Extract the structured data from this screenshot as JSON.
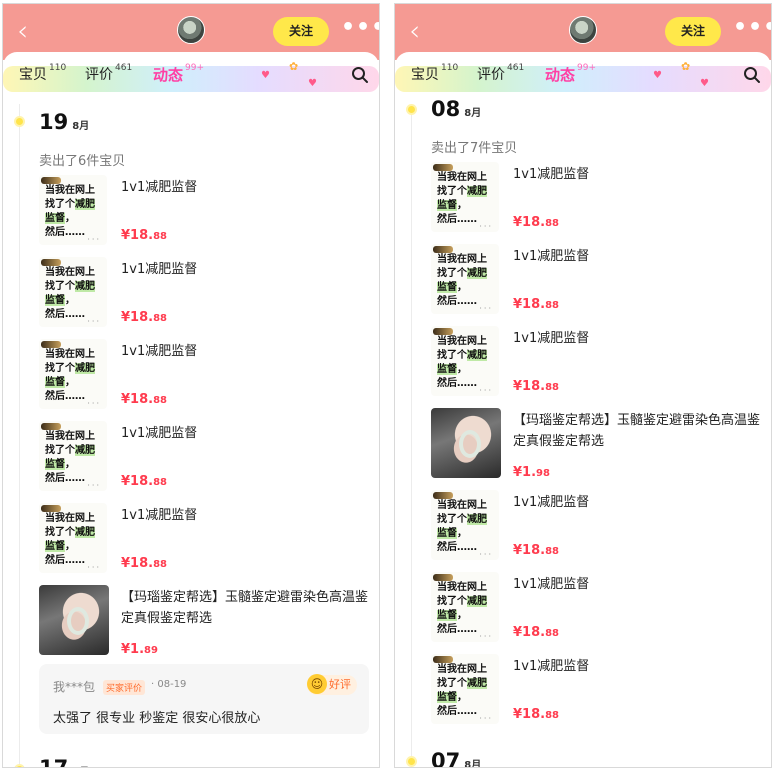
{
  "header": {
    "follow_label": "关注",
    "more_glyph": "•••",
    "back_glyph": "‹"
  },
  "tabs": [
    {
      "label": "宝贝",
      "count": "110"
    },
    {
      "label": "评价",
      "count": "461"
    },
    {
      "label": "动态",
      "count": "99+"
    }
  ],
  "thumb_text": {
    "line1": "当我在网上",
    "line2a": "找了个",
    "line2b": "减肥",
    "line3": "监督",
    "line3b": "，",
    "line4": "然后……",
    "dots": "···"
  },
  "colors": {
    "header_bg": "#f59a93",
    "follow_bg": "#ffe84a",
    "active_tab": "#ff3fa4",
    "price": "#ff3b4e"
  },
  "left": {
    "date1": {
      "day": "19",
      "month": "8月"
    },
    "sold_text": "卖出了6件宝贝",
    "items": [
      {
        "title": "1v1减肥监督",
        "price_main": "¥18.",
        "price_cents": "88"
      },
      {
        "title": "1v1减肥监督",
        "price_main": "¥18.",
        "price_cents": "88"
      },
      {
        "title": "1v1减肥监督",
        "price_main": "¥18.",
        "price_cents": "88"
      },
      {
        "title": "1v1减肥监督",
        "price_main": "¥18.",
        "price_cents": "88"
      },
      {
        "title": "1v1减肥监督",
        "price_main": "¥18.",
        "price_cents": "88"
      },
      {
        "title": "【玛瑙鉴定帮选】玉髓鉴定避雷染色高温鉴定真假鉴定帮选",
        "price_main": "¥1.",
        "price_cents": "89"
      }
    ],
    "review": {
      "user": "我***包",
      "badge": "买家评价",
      "date": "· 08-19",
      "rating": "好评",
      "text": "太强了 很专业 秒鉴定 很安心很放心"
    },
    "date2": {
      "day": "17",
      "month": "8月"
    }
  },
  "right": {
    "date1": {
      "day": "08",
      "month": "8月"
    },
    "sold_text": "卖出了7件宝贝",
    "items": [
      {
        "title": "1v1减肥监督",
        "price_main": "¥18.",
        "price_cents": "88"
      },
      {
        "title": "1v1减肥监督",
        "price_main": "¥18.",
        "price_cents": "88"
      },
      {
        "title": "1v1减肥监督",
        "price_main": "¥18.",
        "price_cents": "88"
      },
      {
        "title": "【玛瑙鉴定帮选】玉髓鉴定避雷染色高温鉴定真假鉴定帮选",
        "price_main": "¥1.",
        "price_cents": "98"
      },
      {
        "title": "1v1减肥监督",
        "price_main": "¥18.",
        "price_cents": "88"
      },
      {
        "title": "1v1减肥监督",
        "price_main": "¥18.",
        "price_cents": "88"
      },
      {
        "title": "1v1减肥监督",
        "price_main": "¥18.",
        "price_cents": "88"
      }
    ],
    "date2": {
      "day": "07",
      "month": "8月"
    }
  }
}
